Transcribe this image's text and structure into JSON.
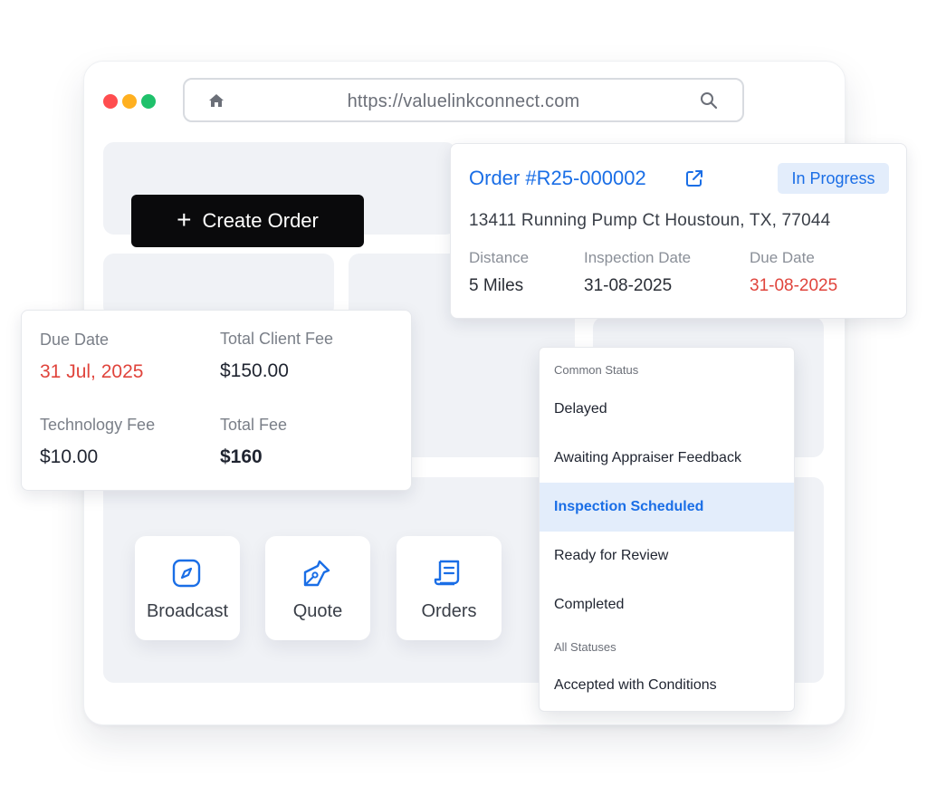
{
  "browser": {
    "url": "https://valuelinkconnect.com",
    "traffic_lights": {
      "red": "#ff4d4f",
      "yellow": "#ffb020",
      "green": "#1fc16b"
    },
    "home_icon": "home-icon",
    "search_icon": "search-icon"
  },
  "create_order": {
    "label": "Create Order",
    "icon": "plus-icon"
  },
  "order": {
    "title": "Order #R25-000002",
    "status": "In Progress",
    "address": "13411 Running Pump Ct Houstoun, TX, 77044",
    "distance_label": "Distance",
    "distance_value": "5 Miles",
    "inspection_label": "Inspection Date",
    "inspection_value": "31-08-2025",
    "due_label": "Due Date",
    "due_value": "31-08-2025"
  },
  "fees": {
    "due_date_label": "Due Date",
    "due_date_value": "31 Jul, 2025",
    "client_fee_label": "Total Client Fee",
    "client_fee_value": "$150.00",
    "tech_fee_label": "Technology Fee",
    "tech_fee_value": "$10.00",
    "total_fee_label": "Total Fee",
    "total_fee_value": "$160"
  },
  "actions": [
    {
      "label": "Broadcast",
      "icon": "compass-icon"
    },
    {
      "label": "Quote",
      "icon": "pen-nib-icon"
    },
    {
      "label": "Orders",
      "icon": "receipt-icon"
    }
  ],
  "status_menu": {
    "common_header": "Common Status",
    "items": [
      "Delayed",
      "Awaiting Appraiser Feedback",
      "Inspection Scheduled",
      "Ready for Review",
      "Completed"
    ],
    "selected": "Inspection Scheduled",
    "all_header": "All Statuses",
    "all_items": [
      "Accepted with Conditions"
    ]
  },
  "colors": {
    "accent": "#1a6ee6",
    "danger": "#e0443c",
    "pill_bg": "#e3edfb",
    "button_bg": "#0a0a0c"
  }
}
